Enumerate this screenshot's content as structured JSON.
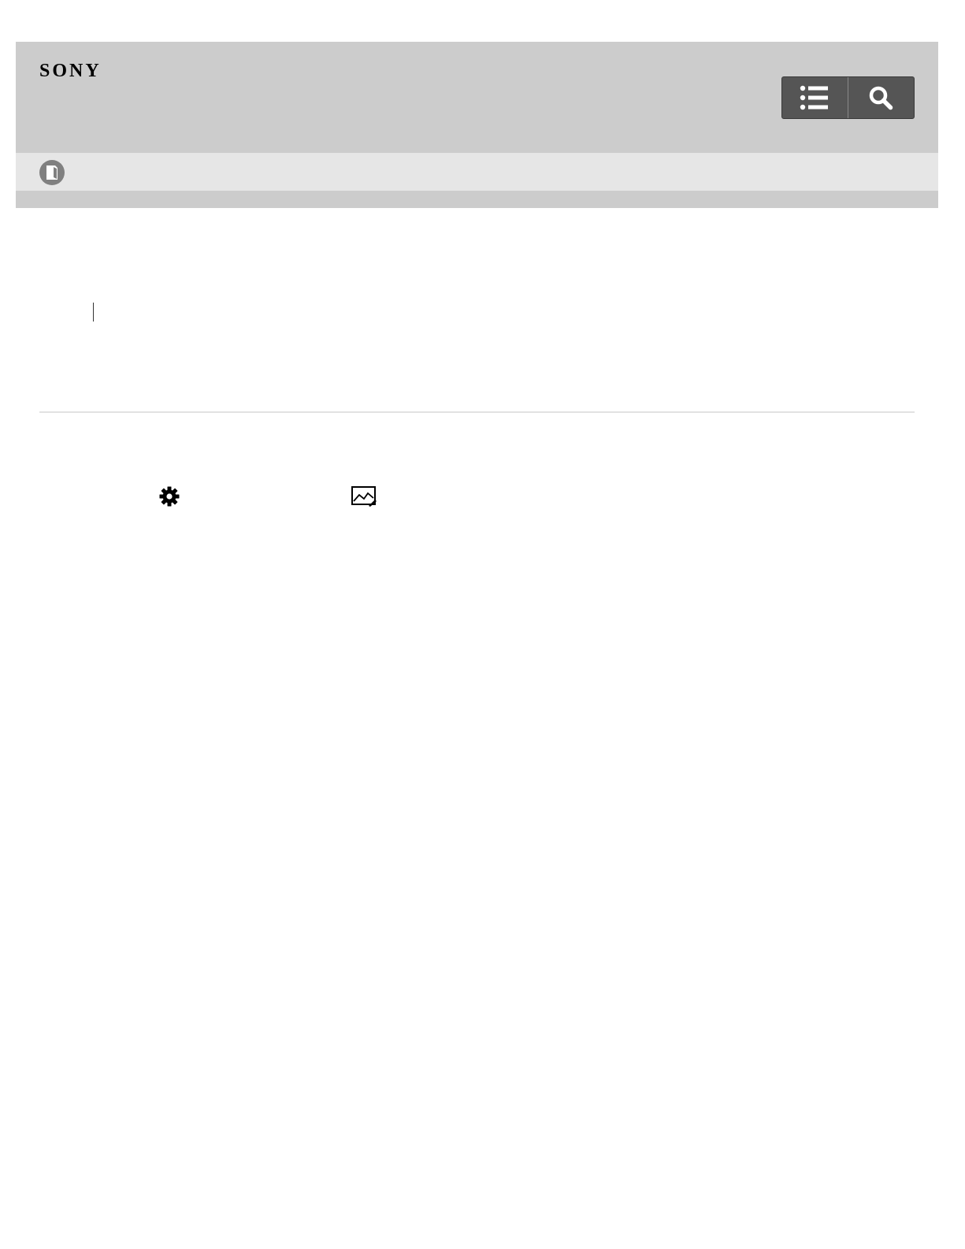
{
  "header": {
    "brand": "SONY",
    "buttons": [
      {
        "icon": "list-icon"
      },
      {
        "icon": "search-icon"
      }
    ]
  },
  "subbar": {
    "icon": "manual-icon"
  },
  "content": {
    "icons": [
      "gear-icon",
      "picture-edit-icon"
    ]
  },
  "colors": {
    "header_bg": "#cccccc",
    "subbar_bg": "#e6e6e6",
    "button_bg": "#555555",
    "divider": "#e2e2e2"
  }
}
